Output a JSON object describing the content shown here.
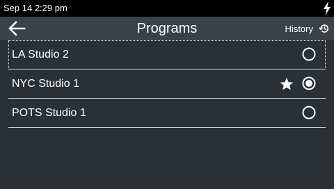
{
  "status": {
    "time": "Sep 14 2:29 pm",
    "power_icon": "lightning-bolt-icon"
  },
  "header": {
    "back_icon": "arrow-left-icon",
    "title": "Programs",
    "history_label": "History",
    "history_icon": "history-icon"
  },
  "programs": [
    {
      "name": "LA Studio 2",
      "selected": false,
      "favorite": false,
      "focused": true
    },
    {
      "name": "NYC Studio 1",
      "selected": true,
      "favorite": true,
      "focused": false
    },
    {
      "name": "POTS Studio 1",
      "selected": false,
      "favorite": false,
      "focused": false
    }
  ],
  "colors": {
    "background": "#2a3136",
    "header": "#394249",
    "statusbar": "#000000",
    "text": "#ffffff",
    "divider": "#c8cdd0"
  }
}
